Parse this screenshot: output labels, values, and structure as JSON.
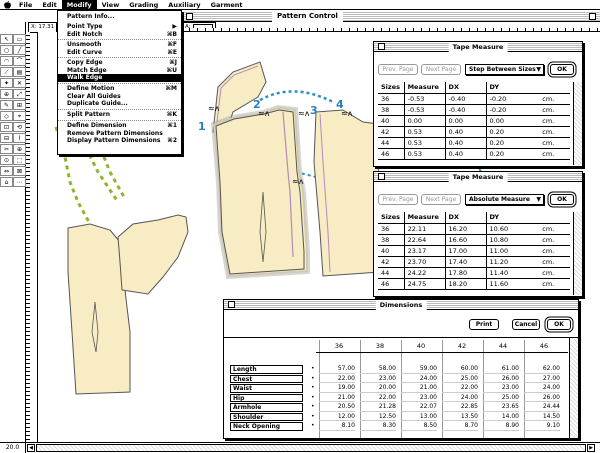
{
  "menubar": {
    "apple": "",
    "items": [
      "File",
      "Edit",
      "Modify",
      "View",
      "Grading",
      "Auxiliary",
      "Garment"
    ],
    "active": "Modify"
  },
  "modify_menu": {
    "items": [
      {
        "label": "Pattern Info...",
        "shortcut": ""
      },
      {
        "label": "Point Type",
        "shortcut": "▶"
      },
      {
        "label": "Edit Notch",
        "shortcut": "⌘B"
      },
      {
        "label": "Unsmooth",
        "shortcut": "⌘F"
      },
      {
        "label": "Edit Curve",
        "shortcut": "⌘E"
      },
      {
        "label": "Copy Edge",
        "shortcut": "⌘J"
      },
      {
        "label": "Match Edge",
        "shortcut": "⌘U"
      },
      {
        "label": "Walk Edge",
        "shortcut": ""
      },
      {
        "label": "Define Motion",
        "shortcut": "⌘M"
      },
      {
        "label": "Clear All Guides",
        "shortcut": ""
      },
      {
        "label": "Duplicate Guide...",
        "shortcut": ""
      },
      {
        "label": "Split Pattern",
        "shortcut": "⌘K"
      },
      {
        "label": "Define Dimension",
        "shortcut": "⌘1"
      },
      {
        "label": "Remove Pattern Dimensions",
        "shortcut": ""
      },
      {
        "label": "Display Pattern Dimensions",
        "shortcut": "⌘2"
      }
    ],
    "highlighted": "Walk Edge"
  },
  "main_window": {
    "title": "Pattern Control",
    "coord_x": "X: 17.31",
    "coord_a": "A:",
    "zoom": "20.0"
  },
  "canvas_labels": [
    "1",
    "2",
    "3",
    "4"
  ],
  "tape1": {
    "title": "Tape Measure",
    "prev": "Prev. Page",
    "next": "Next Page",
    "mode": "Step Between Sizes",
    "ok": "OK",
    "headers": [
      "Sizes",
      "Measure",
      "DX",
      "DY",
      ""
    ],
    "rows": [
      [
        "36",
        "-0.53",
        "-0.40",
        "-0.20",
        "cm."
      ],
      [
        "38",
        "-0.53",
        "-0.40",
        "-0.20",
        "cm."
      ],
      [
        "40",
        "0.00",
        "0.00",
        "0.00",
        "cm."
      ],
      [
        "42",
        "0.53",
        "0.40",
        "0.20",
        "cm."
      ],
      [
        "44",
        "0.53",
        "0.40",
        "0.20",
        "cm."
      ],
      [
        "46",
        "0.53",
        "0.40",
        "0.20",
        "cm."
      ]
    ]
  },
  "tape2": {
    "title": "Tape Measure",
    "prev": "Prev. Page",
    "next": "Next Page",
    "mode": "Absolute Measure",
    "ok": "OK",
    "headers": [
      "Sizes",
      "Measure",
      "DX",
      "DY",
      ""
    ],
    "rows": [
      [
        "36",
        "22.11",
        "16.20",
        "10.60",
        "cm."
      ],
      [
        "38",
        "22.64",
        "16.60",
        "10.80",
        "cm."
      ],
      [
        "40",
        "23.17",
        "17.00",
        "11.00",
        "cm."
      ],
      [
        "42",
        "23.70",
        "17.40",
        "11.20",
        "cm."
      ],
      [
        "44",
        "24.22",
        "17.80",
        "11.40",
        "cm."
      ],
      [
        "46",
        "24.75",
        "18.20",
        "11.60",
        "cm."
      ]
    ]
  },
  "dimensions": {
    "title": "Dimensions",
    "print": "Print",
    "cancel": "Cancel",
    "ok": "OK",
    "sizes": [
      "36",
      "38",
      "40",
      "42",
      "44",
      "46"
    ],
    "rows": [
      {
        "label": "Length",
        "values": [
          "57.00",
          "58.00",
          "59.00",
          "60.00",
          "61.00",
          "62.00"
        ]
      },
      {
        "label": "Chest",
        "values": [
          "22.00",
          "23.00",
          "24.00",
          "25.00",
          "26.00",
          "27.00"
        ]
      },
      {
        "label": "Waist",
        "values": [
          "19.00",
          "20.00",
          "21.00",
          "22.00",
          "23.00",
          "24.00"
        ]
      },
      {
        "label": "Hip",
        "values": [
          "21.00",
          "22.00",
          "23.00",
          "24.00",
          "25.00",
          "26.00"
        ]
      },
      {
        "label": "Armhole",
        "values": [
          "20.50",
          "21.28",
          "22.07",
          "22.85",
          "23.65",
          "24.44"
        ]
      },
      {
        "label": "Shoulder",
        "values": [
          "12.00",
          "12.50",
          "13.00",
          "13.50",
          "14.00",
          "14.50"
        ]
      },
      {
        "label": "Neck Opening",
        "values": [
          "8.10",
          "8.30",
          "8.50",
          "8.70",
          "8.90",
          "9.10"
        ]
      }
    ],
    "bullet": "•"
  },
  "colors": {
    "pattern_fill": "#f7ecc4",
    "arrow_green": "#8db52e",
    "arrow_blue": "#2f8fc4",
    "label_blue": "#2a7fc0"
  }
}
